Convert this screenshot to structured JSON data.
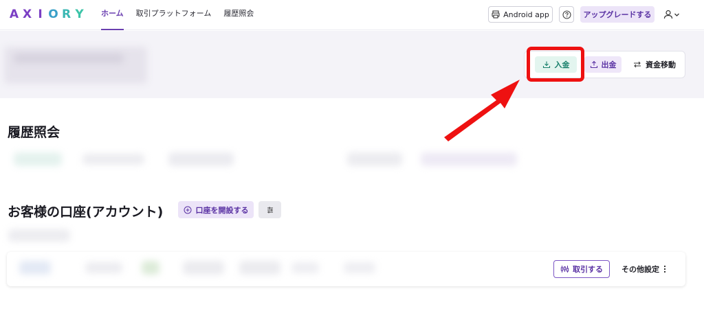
{
  "header": {
    "logo_letters": [
      "A",
      "X",
      "I",
      "O",
      "R",
      "Y"
    ],
    "logo_colors": [
      "#7b3fc4",
      "#7b3fc4",
      "#7b3fc4",
      "#3aa0c8",
      "#3ab7b3",
      "#3cc4a8"
    ],
    "nav": [
      {
        "label": "ホーム",
        "active": true
      },
      {
        "label": "取引プラットフォーム",
        "active": false
      },
      {
        "label": "履歴照会",
        "active": false
      }
    ],
    "android_button": "Android app",
    "upgrade_button": "アップグレードする"
  },
  "actions": {
    "deposit": "入金",
    "withdraw": "出金",
    "transfer": "資金移動"
  },
  "history": {
    "title": "履歴照会"
  },
  "accounts": {
    "title": "お客様の口座(アカウント)",
    "open_account_button": "口座を開設する",
    "trade_button": "取引する",
    "other_settings": "その他設定"
  },
  "colors": {
    "brand_purple": "#6a3fb0",
    "deposit_green": "#18806b",
    "annotation_red": "#ee1111"
  },
  "icons": {
    "android": "printer-like-icon",
    "help": "question-icon",
    "user": "user-icon",
    "deposit": "download-tray-icon",
    "withdraw": "upload-tray-icon",
    "transfer": "arrows-left-right-icon",
    "open_account": "plus-circle-icon",
    "filter": "sliders-icon",
    "trade": "candlestick-icon",
    "more": "kebab-icon"
  }
}
